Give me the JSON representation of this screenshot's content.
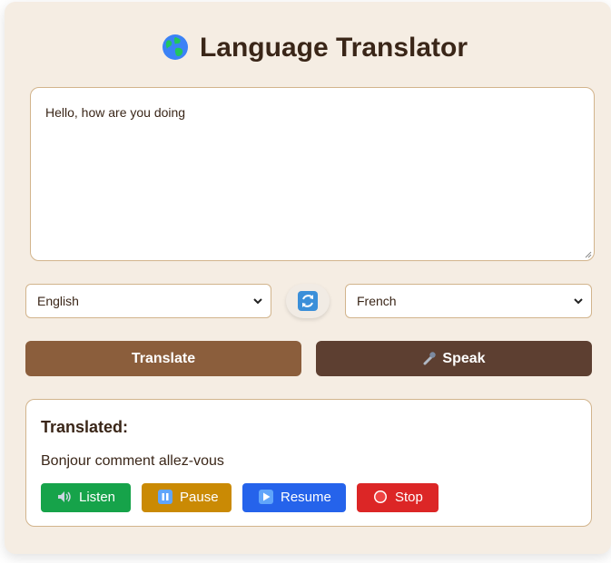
{
  "header": {
    "title": "Language Translator"
  },
  "input": {
    "text": "Hello, how are you doing"
  },
  "languages": {
    "source": "English",
    "target": "French"
  },
  "actions": {
    "translate_label": "Translate",
    "speak_label": "Speak"
  },
  "result": {
    "heading": "Translated:",
    "text": "Bonjour comment allez-vous"
  },
  "controls": {
    "listen_label": "Listen",
    "pause_label": "Pause",
    "resume_label": "Resume",
    "stop_label": "Stop"
  },
  "colors": {
    "card_background": "#f5ede3",
    "translate_button": "#8b5e3c",
    "speak_button": "#5d3f31",
    "listen_button": "#16a34a",
    "pause_button": "#ca8a04",
    "resume_button": "#2563eb",
    "stop_button": "#dc2626"
  },
  "icons": {
    "title": "globe-icon",
    "swap": "swap-icon",
    "speak": "microphone-icon",
    "listen": "speaker-icon",
    "pause": "pause-icon",
    "resume": "play-icon",
    "stop": "record-icon"
  }
}
